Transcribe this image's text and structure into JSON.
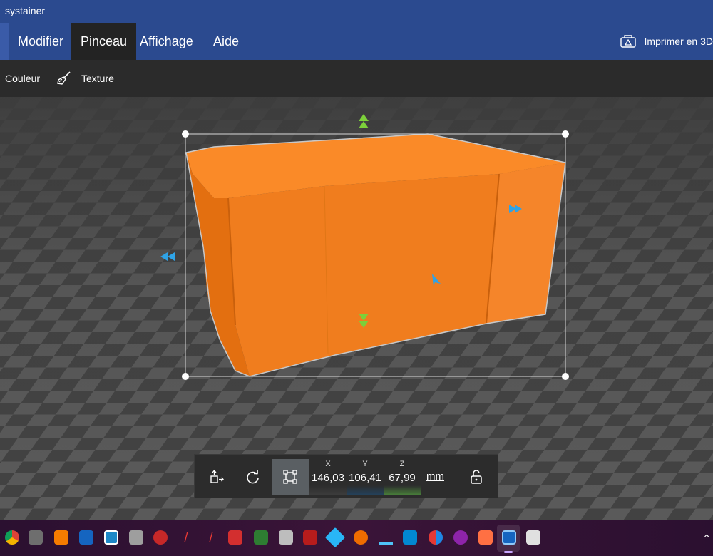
{
  "window": {
    "title": "systainer"
  },
  "menu": {
    "tabs": [
      {
        "label": "Modifier"
      },
      {
        "label": "Pinceau"
      },
      {
        "label": "Affichage"
      },
      {
        "label": "Aide"
      }
    ],
    "active_tab": "Pinceau",
    "print_label": "Imprimer en 3D"
  },
  "toolbar": {
    "color_label": "Couleur",
    "texture_label": "Texture"
  },
  "model": {
    "fill_color": "#f58220",
    "name_icon": "orange-box-model"
  },
  "transform": {
    "x_label": "X",
    "x_value": "146,03",
    "y_label": "Y",
    "y_value": "106,41",
    "z_label": "Z",
    "z_value": "67,99",
    "unit": "mm"
  },
  "colors": {
    "accent_blue": "#2b4a8f",
    "x_axis": "#c0392b",
    "y_axis": "#1f4e79",
    "z_axis": "#4c8a3c",
    "handle_green": "#7cd03a",
    "handle_blue": "#2fa3e6"
  },
  "taskbar": {
    "icons": [
      "chrome-icon",
      "gimp-icon",
      "fusion-icon",
      "sketchup-icon",
      "kdenlive-icon",
      "file-manager-icon",
      "tool-red-icon",
      "pdf-red-icon",
      "pdf-dark-icon",
      "acrobat-icon",
      "spreadsheet-icon",
      "printer-icon",
      "filezilla-icon",
      "kodi-icon",
      "ubuntu-icon",
      "dolphin-icon",
      "cura-icon",
      "mixer-icon",
      "music-icon",
      "store-icon",
      "3d-builder-icon",
      "remote-desktop-icon"
    ]
  }
}
